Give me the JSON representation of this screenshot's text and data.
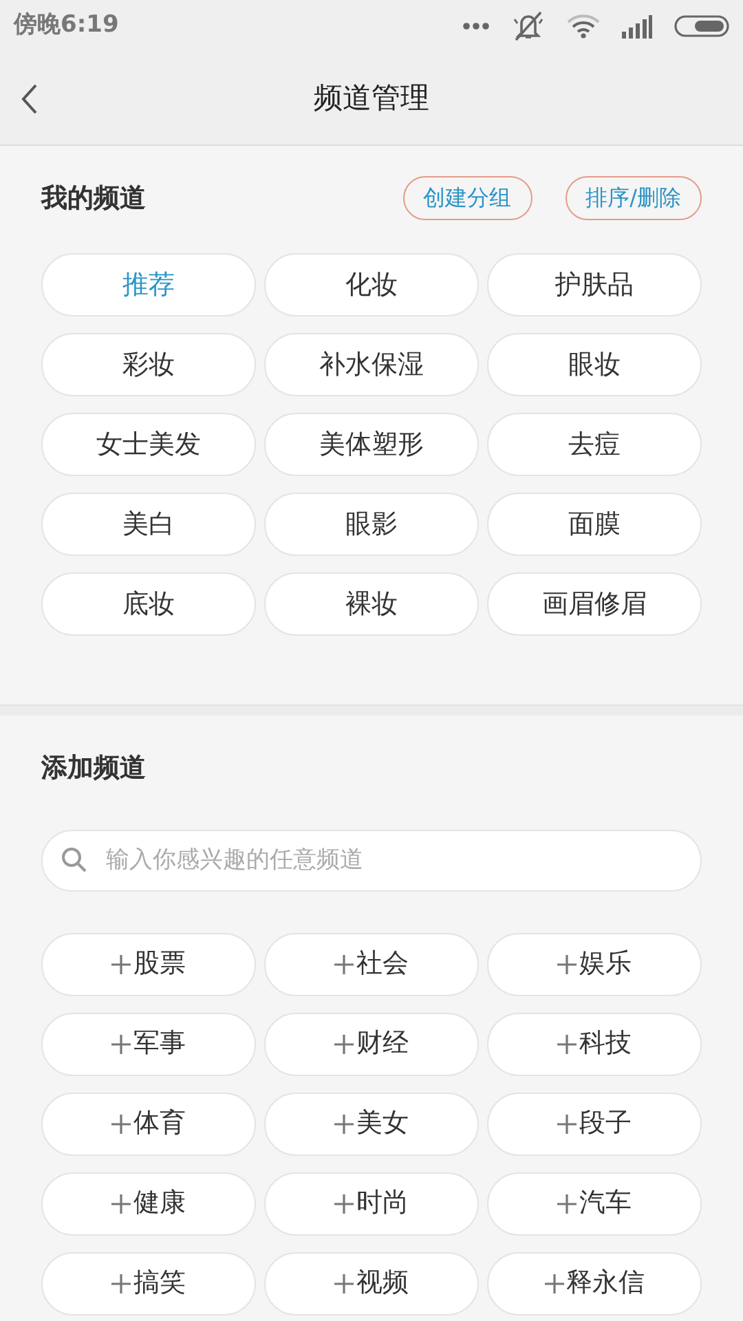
{
  "status_bar": {
    "time": "傍晚6:19"
  },
  "header": {
    "title": "频道管理"
  },
  "my_channels": {
    "title": "我的频道",
    "actions": [
      "创建分组",
      "排序/删除"
    ],
    "channels": [
      {
        "label": "推荐",
        "selected": true
      },
      {
        "label": "化妆",
        "selected": false
      },
      {
        "label": "护肤品",
        "selected": false
      },
      {
        "label": "彩妆",
        "selected": false
      },
      {
        "label": "补水保湿",
        "selected": false
      },
      {
        "label": "眼妆",
        "selected": false
      },
      {
        "label": "女士美发",
        "selected": false
      },
      {
        "label": "美体塑形",
        "selected": false
      },
      {
        "label": "去痘",
        "selected": false
      },
      {
        "label": "美白",
        "selected": false
      },
      {
        "label": "眼影",
        "selected": false
      },
      {
        "label": "面膜",
        "selected": false
      },
      {
        "label": "底妆",
        "selected": false
      },
      {
        "label": "裸妆",
        "selected": false
      },
      {
        "label": "画眉修眉",
        "selected": false
      }
    ]
  },
  "add_channels": {
    "title": "添加频道",
    "search": {
      "placeholder": "输入你感兴趣的任意频道"
    },
    "channels": [
      "股票",
      "社会",
      "娱乐",
      "军事",
      "财经",
      "科技",
      "体育",
      "美女",
      "段子",
      "健康",
      "时尚",
      "汽车",
      "搞笑",
      "视频",
      "释永信"
    ]
  }
}
